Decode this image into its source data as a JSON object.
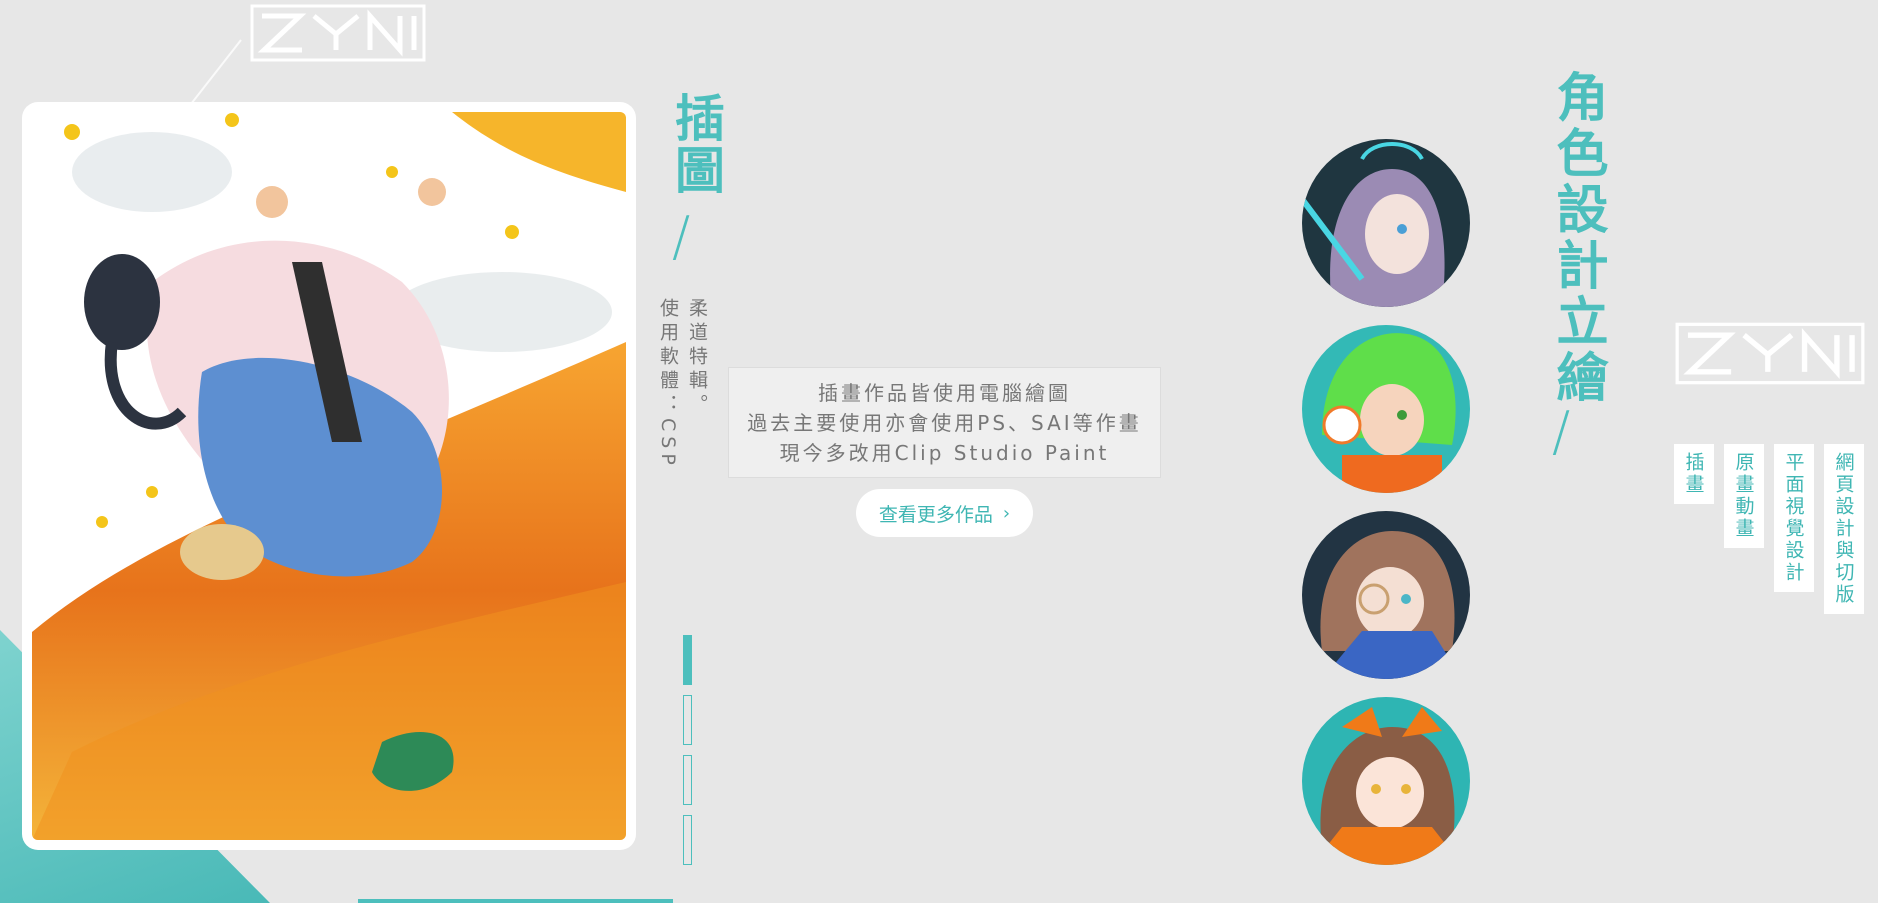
{
  "brand": {
    "logo_text": "ZYNI"
  },
  "illustration": {
    "title": "插圖",
    "slash": "/",
    "subtitle": "柔道特輯。",
    "tool": "使用軟體：CSP"
  },
  "pager": {
    "total": 4,
    "active": 1
  },
  "description": {
    "lines": [
      "插畫作品皆使用電腦繪圖",
      "過去主要使用亦會使用PS、SAI等作畫",
      "現今多改用Clip Studio Paint"
    ]
  },
  "more_button": {
    "label": "查看更多作品",
    "icon": "chevron-right-icon"
  },
  "character": {
    "title": "角色設計立繪",
    "slash": "/",
    "avatars": [
      {
        "name": "avatar-purple-hair",
        "bg": "#1f3640",
        "hair": "#9b8bb4"
      },
      {
        "name": "avatar-green-hair",
        "bg": "#33b9b6",
        "hair": "#5fde4a"
      },
      {
        "name": "avatar-brown-hair",
        "bg": "#223443",
        "hair": "#a0735d"
      },
      {
        "name": "avatar-orange-bow",
        "bg": "#2eb5b3",
        "hair": "#8a5d45"
      }
    ]
  },
  "nav": {
    "items": [
      {
        "label": "插畫"
      },
      {
        "label": "原畫動畫"
      },
      {
        "label": "平面視覺設計"
      },
      {
        "label": "網頁設計與切版"
      }
    ]
  },
  "colors": {
    "accent": "#4dbfbd",
    "background": "#e7e7e7",
    "text_gray": "#777777"
  }
}
